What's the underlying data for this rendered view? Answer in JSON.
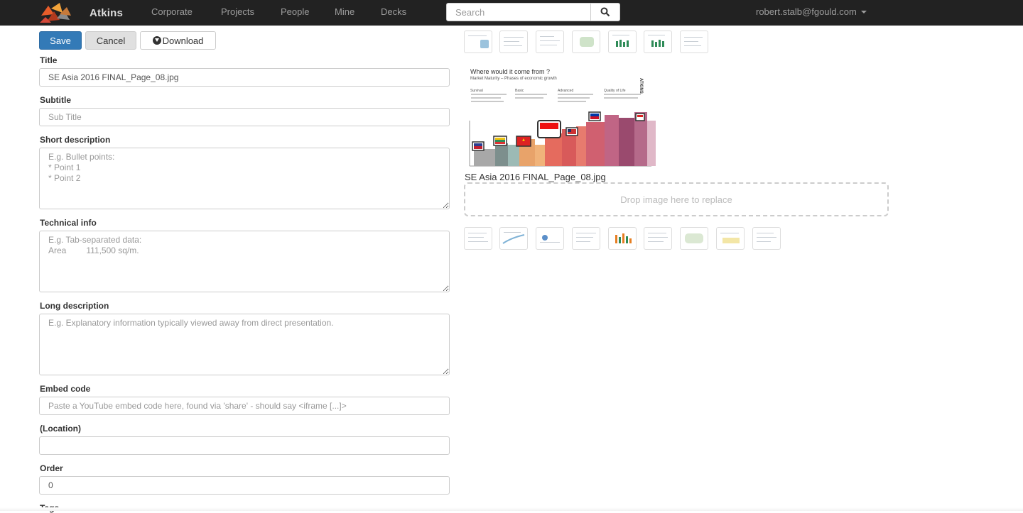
{
  "nav": {
    "brand": "Atkins",
    "items": [
      "Corporate",
      "Projects",
      "People",
      "Mine",
      "Decks"
    ],
    "search_placeholder": "Search",
    "user": "robert.stalb@fgould.com"
  },
  "actions": {
    "save": "Save",
    "cancel": "Cancel",
    "download": "Download"
  },
  "form": {
    "title": {
      "label": "Title",
      "value": "SE Asia 2016 FINAL_Page_08.jpg"
    },
    "subtitle": {
      "label": "Subtitle",
      "placeholder": "Sub Title"
    },
    "short_description": {
      "label": "Short description",
      "placeholder": "E.g. Bullet points:\n* Point 1\n* Point 2"
    },
    "technical_info": {
      "label": "Technical info",
      "placeholder": "E.g. Tab-separated data:\nArea\t111,500 sq/m."
    },
    "long_description": {
      "label": "Long description",
      "placeholder": "E.g. Explanatory information typically viewed away from direct presentation."
    },
    "embed_code": {
      "label": "Embed code",
      "placeholder": "Paste a YouTube embed code here, found via 'share' - should say <iframe [...]>"
    },
    "location": {
      "label": "(Location)",
      "value": ""
    },
    "order": {
      "label": "Order",
      "value": "0"
    },
    "tags": {
      "label": "Tags"
    }
  },
  "preview": {
    "heading": "Where would it come from ?",
    "subheading": "Market Maturity – Phases of economic growth",
    "logo_text": "ATKINS",
    "phases": [
      "Survival",
      "Basic",
      "Advanced",
      "Quality of Life"
    ],
    "caption": "SE Asia 2016 FINAL_Page_08.jpg",
    "dropzone": "Drop image here to replace"
  }
}
